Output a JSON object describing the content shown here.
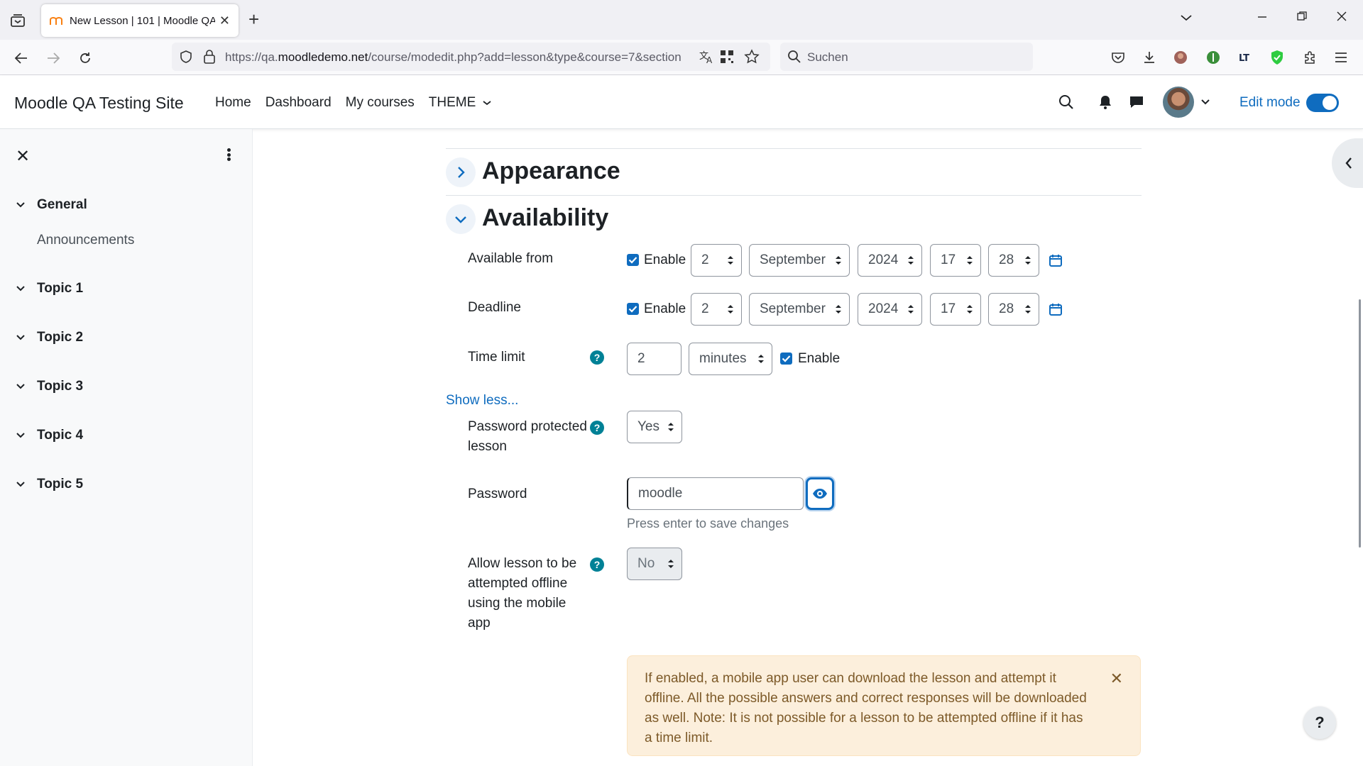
{
  "browser": {
    "tab_title": "New Lesson | 101 | Moodle QA",
    "url_prefix": "https://qa.",
    "url_domain": "moodledemo.net",
    "url_path": "/course/modedit.php?add=lesson&type&course=7&section",
    "search_placeholder": "Suchen"
  },
  "header": {
    "site_name": "Moodle QA Testing Site",
    "nav": [
      "Home",
      "Dashboard",
      "My courses",
      "THEME"
    ],
    "edit_mode_label": "Edit mode"
  },
  "course_index": {
    "sections": [
      {
        "label": "General",
        "items": [
          "Announcements"
        ]
      },
      {
        "label": "Topic 1"
      },
      {
        "label": "Topic 2"
      },
      {
        "label": "Topic 3"
      },
      {
        "label": "Topic 4"
      },
      {
        "label": "Topic 5"
      }
    ]
  },
  "form": {
    "appearance_heading": "Appearance",
    "availability_heading": "Availability",
    "available_from": {
      "label": "Available from",
      "enable_label": "Enable",
      "day": "2",
      "month": "September",
      "year": "2024",
      "hour": "17",
      "minute": "28"
    },
    "deadline": {
      "label": "Deadline",
      "enable_label": "Enable",
      "day": "2",
      "month": "September",
      "year": "2024",
      "hour": "17",
      "minute": "28"
    },
    "time_limit": {
      "label": "Time limit",
      "value": "2",
      "unit": "minutes",
      "enable_label": "Enable"
    },
    "show_less": "Show less...",
    "password_protected": {
      "label_line1": "Password protected",
      "label_line2": "lesson",
      "value": "Yes"
    },
    "password": {
      "label": "Password",
      "value": "moodle",
      "hint": "Press enter to save changes"
    },
    "offline": {
      "label_lines": [
        "Allow lesson to be",
        "attempted offline",
        "using the mobile",
        "app"
      ],
      "value": "No"
    },
    "alert_lines": [
      "If enabled, a mobile app user can download the lesson and attempt it",
      "offline. All the possible answers and correct responses will be downloaded",
      "as well. Note: It is not possible for a lesson to be attempted offline if it has",
      "a time limit."
    ]
  },
  "help_float": "?",
  "colors": {
    "primary": "#0f6cbf",
    "help": "#008196",
    "alert_bg": "#fcefdc"
  }
}
